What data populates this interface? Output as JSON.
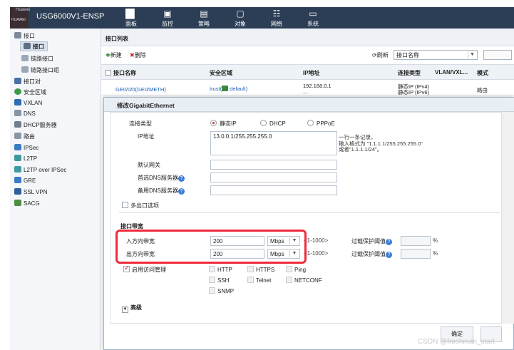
{
  "header": {
    "brand_top": "Huawei",
    "brand_bottom": "HUAWEI",
    "product": "USG6000V1-ENSP",
    "nav": [
      {
        "label": "面板",
        "icon": "dashboard-icon"
      },
      {
        "label": "监控",
        "icon": "monitor-icon"
      },
      {
        "label": "策略",
        "icon": "policy-icon"
      },
      {
        "label": "对象",
        "icon": "object-icon"
      },
      {
        "label": "网络",
        "icon": "network-icon"
      },
      {
        "label": "系统",
        "icon": "system-icon"
      }
    ]
  },
  "sidebar": {
    "items": [
      {
        "label": "接口",
        "icon": "interface-folder-icon"
      },
      {
        "label": "接口",
        "icon": "interface-icon",
        "selected": true
      },
      {
        "label": "链路接口",
        "icon": "link-interface-icon"
      },
      {
        "label": "链路接口组",
        "icon": "link-group-icon"
      },
      {
        "label": "接口对",
        "icon": "interface-pair-icon"
      },
      {
        "label": "安全区域",
        "icon": "security-zone-icon"
      },
      {
        "label": "VXLAN",
        "icon": "vxlan-icon"
      },
      {
        "label": "DNS",
        "icon": "dns-icon"
      },
      {
        "label": "DHCP服务器",
        "icon": "dhcp-icon"
      },
      {
        "label": "路由",
        "icon": "route-icon"
      },
      {
        "label": "IPSec",
        "icon": "ipsec-icon"
      },
      {
        "label": "L2TP",
        "icon": "l2tp-icon"
      },
      {
        "label": "L2TP over IPSec",
        "icon": "l2tp-ipsec-icon"
      },
      {
        "label": "GRE",
        "icon": "gre-icon"
      },
      {
        "label": "SSL VPN",
        "icon": "sslvpn-icon"
      },
      {
        "label": "SACG",
        "icon": "sacg-icon"
      }
    ]
  },
  "list": {
    "title": "接口列表",
    "toolbar": {
      "new": "新建",
      "delete": "删除",
      "refresh": "刷新",
      "filter_value": "接口名称"
    },
    "columns": [
      "接口名称",
      "安全区域",
      "IP地址",
      "连接类型",
      "VLAN/VXL...",
      "模式"
    ],
    "rows": [
      {
        "name": "GE0/0/0(GE0/METH)",
        "zone": "trust(",
        "zone_tail": " default)",
        "ip": "192.168.0.1",
        "ip2": "...",
        "conn": "静态IP (IPv4)",
        "conn2": "静态IP (IPv6)",
        "mode": "路由"
      }
    ]
  },
  "dialog": {
    "title": "修改GigabitEthernet",
    "conn_type_label": "连接类型",
    "conn_options": [
      "静态IP",
      "DHCP",
      "PPPoE"
    ],
    "ip_label": "IP地址",
    "ip_value": "13.0.0.1/255.255.255.0",
    "ip_hint": [
      "一行一条记录，",
      "输入格式为 \"1.1.1.1/255.255.255.0\"",
      "或者\"1.1.1.1/24\"。"
    ],
    "gateway_label": "默认网关",
    "dns1_label": "首选DNS服务器",
    "dns2_label": "备用DNS服务器",
    "multi_exit_label": "多出口选项",
    "bandwidth_section": "接口带宽",
    "in_bw_label": "入方向带宽",
    "in_bw_value": "200",
    "out_bw_label": "出方向带宽",
    "out_bw_value": "200",
    "unit": "Mbps",
    "range_in": "<1-1000>",
    "range_out": "<1-1000>",
    "overload_label_in": "过载保护阈值",
    "overload_label_out": "过载保护阈值",
    "percent": "%",
    "access_mgmt_label": "启用访问管理",
    "protocols": [
      "HTTP",
      "HTTPS",
      "Ping",
      "SSH",
      "Telnet",
      "NETCONF",
      "SNMP"
    ],
    "advanced_label": "高级",
    "ok_label": "确定"
  },
  "watermark": "CSDN @freshman_start",
  "colors": {
    "topbar": "#2c3e55",
    "highlight_box": "#ef2b3c",
    "link": "#1d5fb4"
  }
}
